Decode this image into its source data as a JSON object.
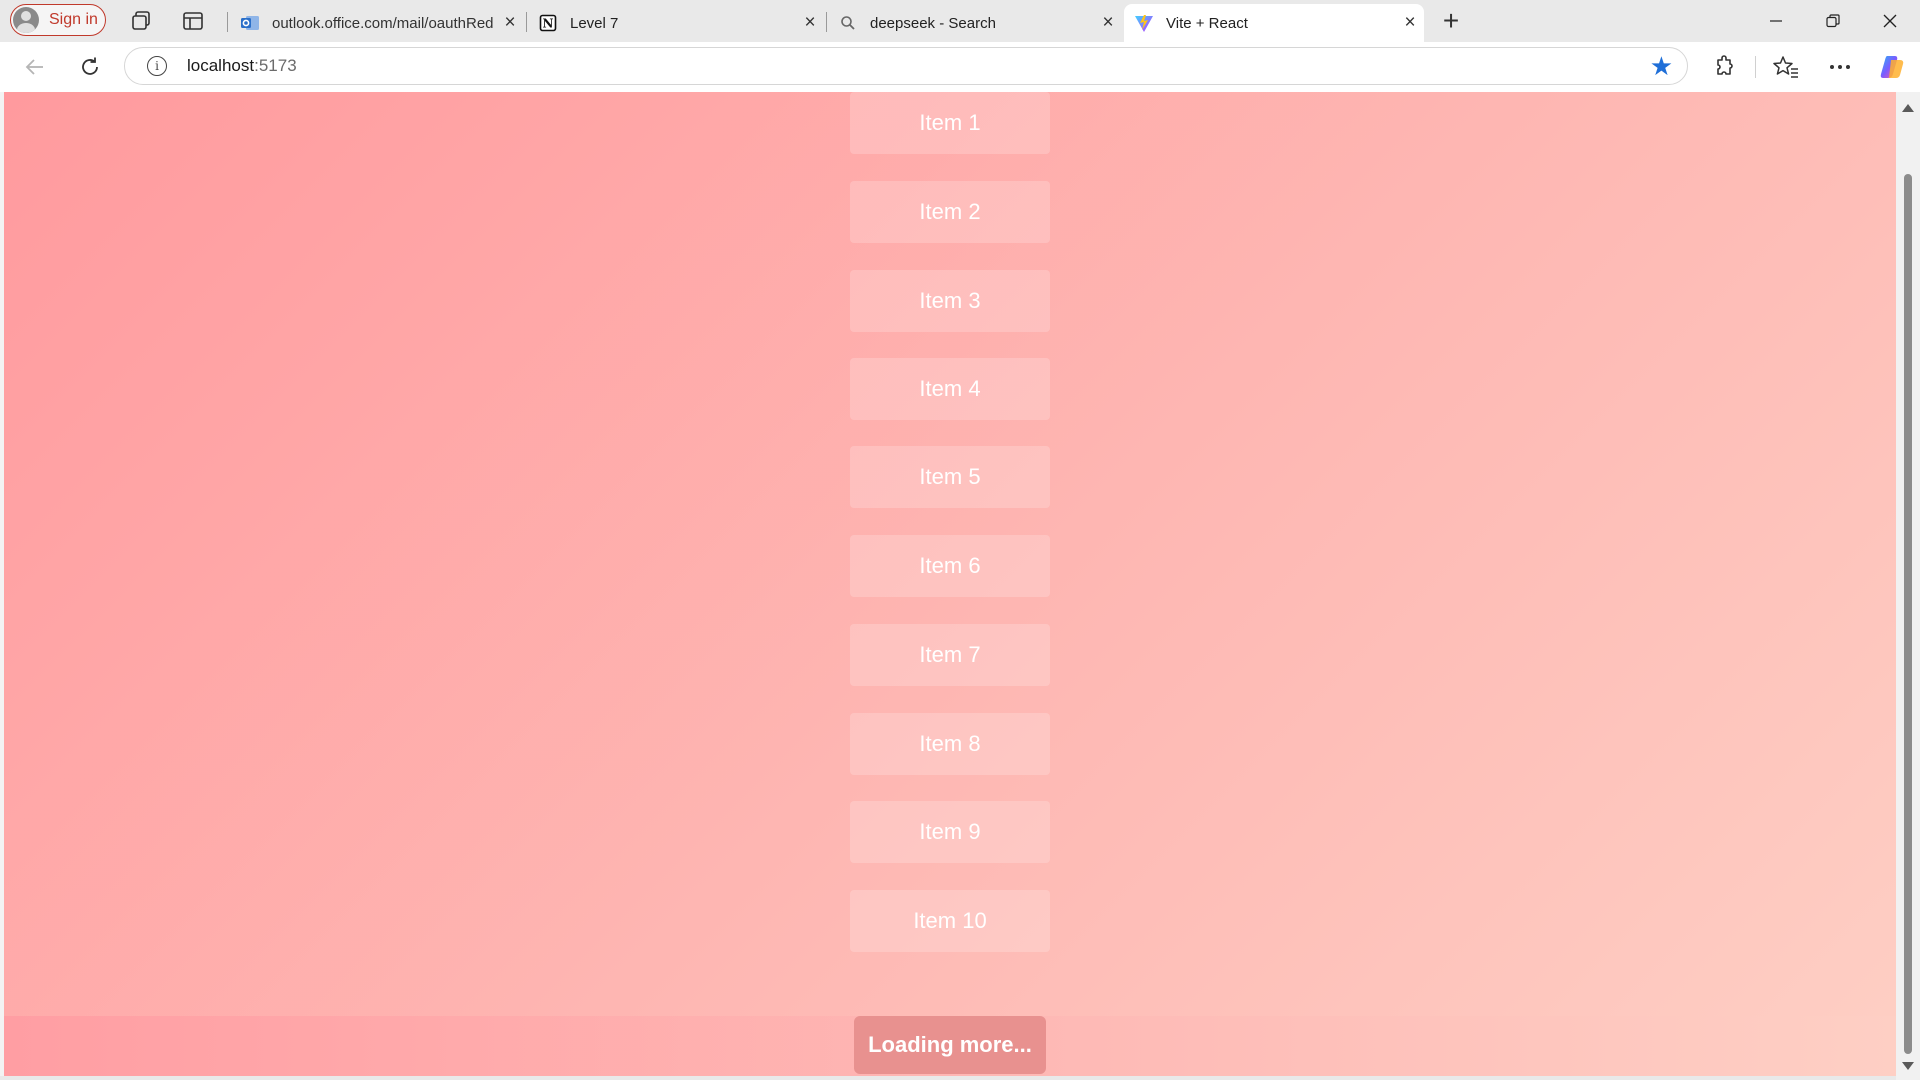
{
  "browser": {
    "signin_label": "Sign in",
    "tabs": [
      {
        "title": "outlook.office.com/mail/oauthRed",
        "close": "×",
        "favicon": "outlook-icon"
      },
      {
        "title": "Level 7",
        "close": "×",
        "favicon": "notion-icon"
      },
      {
        "title": "deepseek - Search",
        "close": "×",
        "favicon": "search-icon"
      },
      {
        "title": "Vite + React",
        "close": "×",
        "favicon": "vite-icon",
        "active": true
      }
    ],
    "new_tab": "+",
    "address": {
      "host": "localhost",
      "port": ":5173"
    },
    "colors": {
      "accent": "#1f6fd8",
      "signin": "#c0392b"
    }
  },
  "page": {
    "items": [
      "Item 1",
      "Item 2",
      "Item 3",
      "Item 4",
      "Item 5",
      "Item 6",
      "Item 7",
      "Item 8",
      "Item 9",
      "Item 10"
    ],
    "loading_text": "Loading more...",
    "colors": {
      "gradient_start": "#ff9a9e",
      "gradient_end": "#fecfc4",
      "loading_pill": "#e8918f"
    }
  }
}
